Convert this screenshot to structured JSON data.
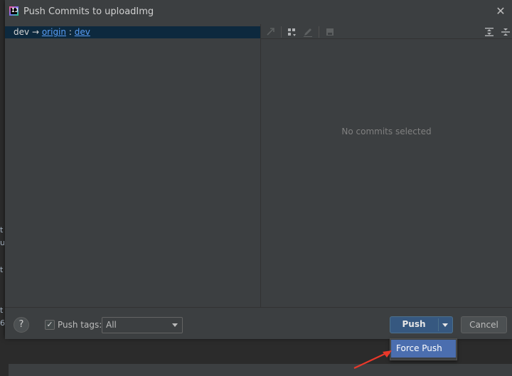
{
  "dialog": {
    "title": "Push Commits to uploadImg",
    "app_icon_letter": "IJ",
    "close_glyph": "✕"
  },
  "branch": {
    "local": "dev",
    "arrow": "→",
    "remote": "origin",
    "separator": ":",
    "remote_branch": "dev"
  },
  "details": {
    "empty_text": "No commits selected"
  },
  "toolbar": {
    "icons": [
      "cherry-pick-icon",
      "group-by-icon",
      "edit-icon",
      "save-icon",
      "expand-all-icon",
      "collapse-all-icon"
    ]
  },
  "footer": {
    "help_label": "?",
    "push_tags_label": "Push tags:",
    "push_tags_checked": true,
    "tags_select_value": "All",
    "push_label": "Push",
    "cancel_label": "Cancel"
  },
  "popup": {
    "force_push_label": "Force Push"
  },
  "colors": {
    "dialog_bg": "#3c3f41",
    "selection_bg": "#0d293e",
    "link": "#589df6",
    "primary_button": "#365880",
    "popup_highlight": "#4b6eaf",
    "annotation_arrow": "#e8382a"
  }
}
